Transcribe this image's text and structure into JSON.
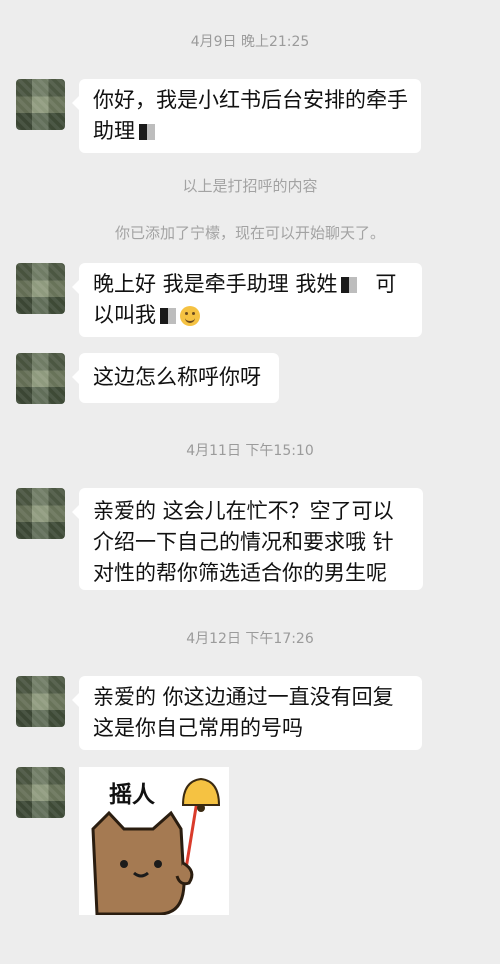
{
  "messages": {
    "ts1": "4月9日 晚上21:25",
    "m1_l1": "你好，我是小红书后台安排的牵手",
    "m1_l2": "助理",
    "sys1": "以上是打招呼的内容",
    "sys2": "你已添加了宁檬，现在可以开始聊天了。",
    "m2_l1": "晚上好  我是牵手助理  我姓",
    "m2_l1b": "可",
    "m2_l2": "以叫我",
    "m3": "这边怎么称呼你呀",
    "ts2": "4月11日 下午15:10",
    "m4_l1": "亲爱的  这会儿在忙不？空了可以",
    "m4_l2": "介绍一下自己的情况和要求哦  针",
    "m4_l3": "对性的帮你筛选适合你的男生呢",
    "ts3": "4月12日 下午17:26",
    "m5_l1": "亲爱的  你这边通过一直没有回复",
    "m5_l2": "这是你自己常用的号吗",
    "sticker_text": "摇人"
  },
  "colors": {
    "background": "#ededed",
    "bubble": "#ffffff",
    "bell": "#f5c242",
    "cat": "#a57a52"
  }
}
